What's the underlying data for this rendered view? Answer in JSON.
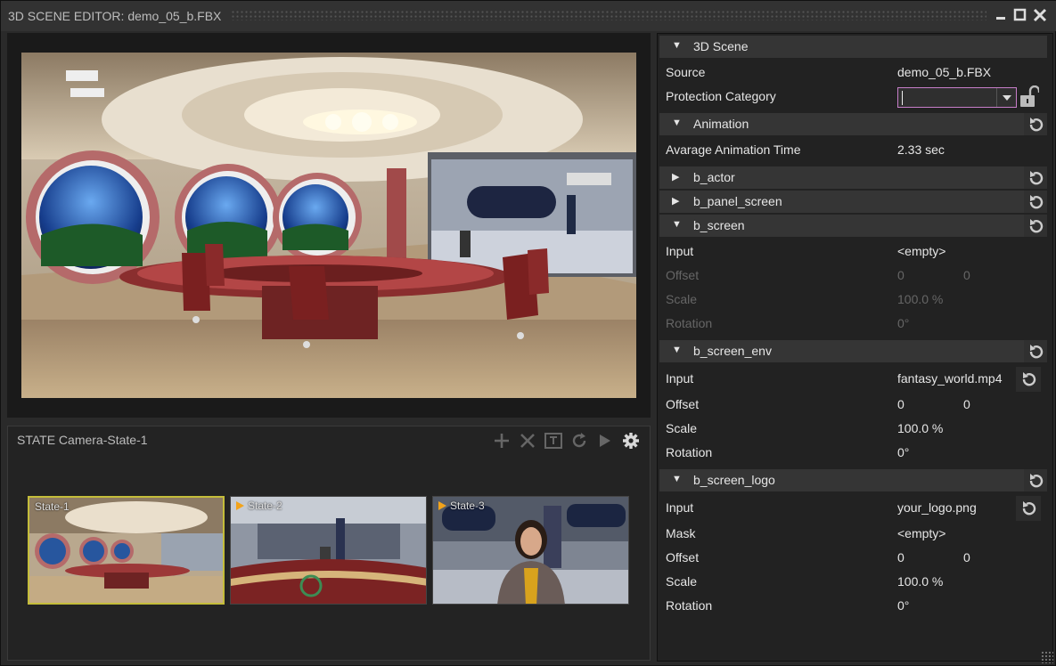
{
  "window": {
    "title": "3D SCENE EDITOR: demo_05_b.FBX"
  },
  "state_panel": {
    "label": "STATE Camera-State-1",
    "tools": [
      "add-icon",
      "delete-icon",
      "text-edit-icon",
      "refresh-icon",
      "play-icon",
      "gear-icon"
    ],
    "thumbnails": [
      {
        "name": "State-1",
        "selected": true
      },
      {
        "name": "State-2",
        "selected": false
      },
      {
        "name": "State-3",
        "selected": false
      }
    ]
  },
  "properties": {
    "scene": {
      "title": "3D Scene",
      "source_label": "Source",
      "source_value": "demo_05_b.FBX",
      "protection_label": "Protection Category",
      "protection_value": ""
    },
    "animation": {
      "title": "Animation",
      "avg_label": "Avarage Animation Time",
      "avg_value": "2.33 sec"
    },
    "b_actor": {
      "title": "b_actor"
    },
    "b_panel_screen": {
      "title": "b_panel_screen"
    },
    "b_screen": {
      "title": "b_screen",
      "input_label": "Input",
      "input_value": "<empty>",
      "offset_label": "Offset",
      "offset_x": "0",
      "offset_y": "0",
      "scale_label": "Scale",
      "scale_value": "100.0 %",
      "rotation_label": "Rotation",
      "rotation_value": "0°"
    },
    "b_screen_env": {
      "title": "b_screen_env",
      "input_label": "Input",
      "input_value": "fantasy_world.mp4",
      "offset_label": "Offset",
      "offset_x": "0",
      "offset_y": "0",
      "scale_label": "Scale",
      "scale_value": "100.0 %",
      "rotation_label": "Rotation",
      "rotation_value": "0°"
    },
    "b_screen_logo": {
      "title": "b_screen_logo",
      "input_label": "Input",
      "input_value": "your_logo.png",
      "mask_label": "Mask",
      "mask_value": "<empty>",
      "offset_label": "Offset",
      "offset_x": "0",
      "offset_y": "0",
      "scale_label": "Scale",
      "scale_value": "100.0 %",
      "rotation_label": "Rotation",
      "rotation_value": "0°"
    }
  },
  "colors": {
    "accent": "#c77ec9",
    "selection": "#c4bd3a",
    "state_marker": "#f2a31b"
  }
}
